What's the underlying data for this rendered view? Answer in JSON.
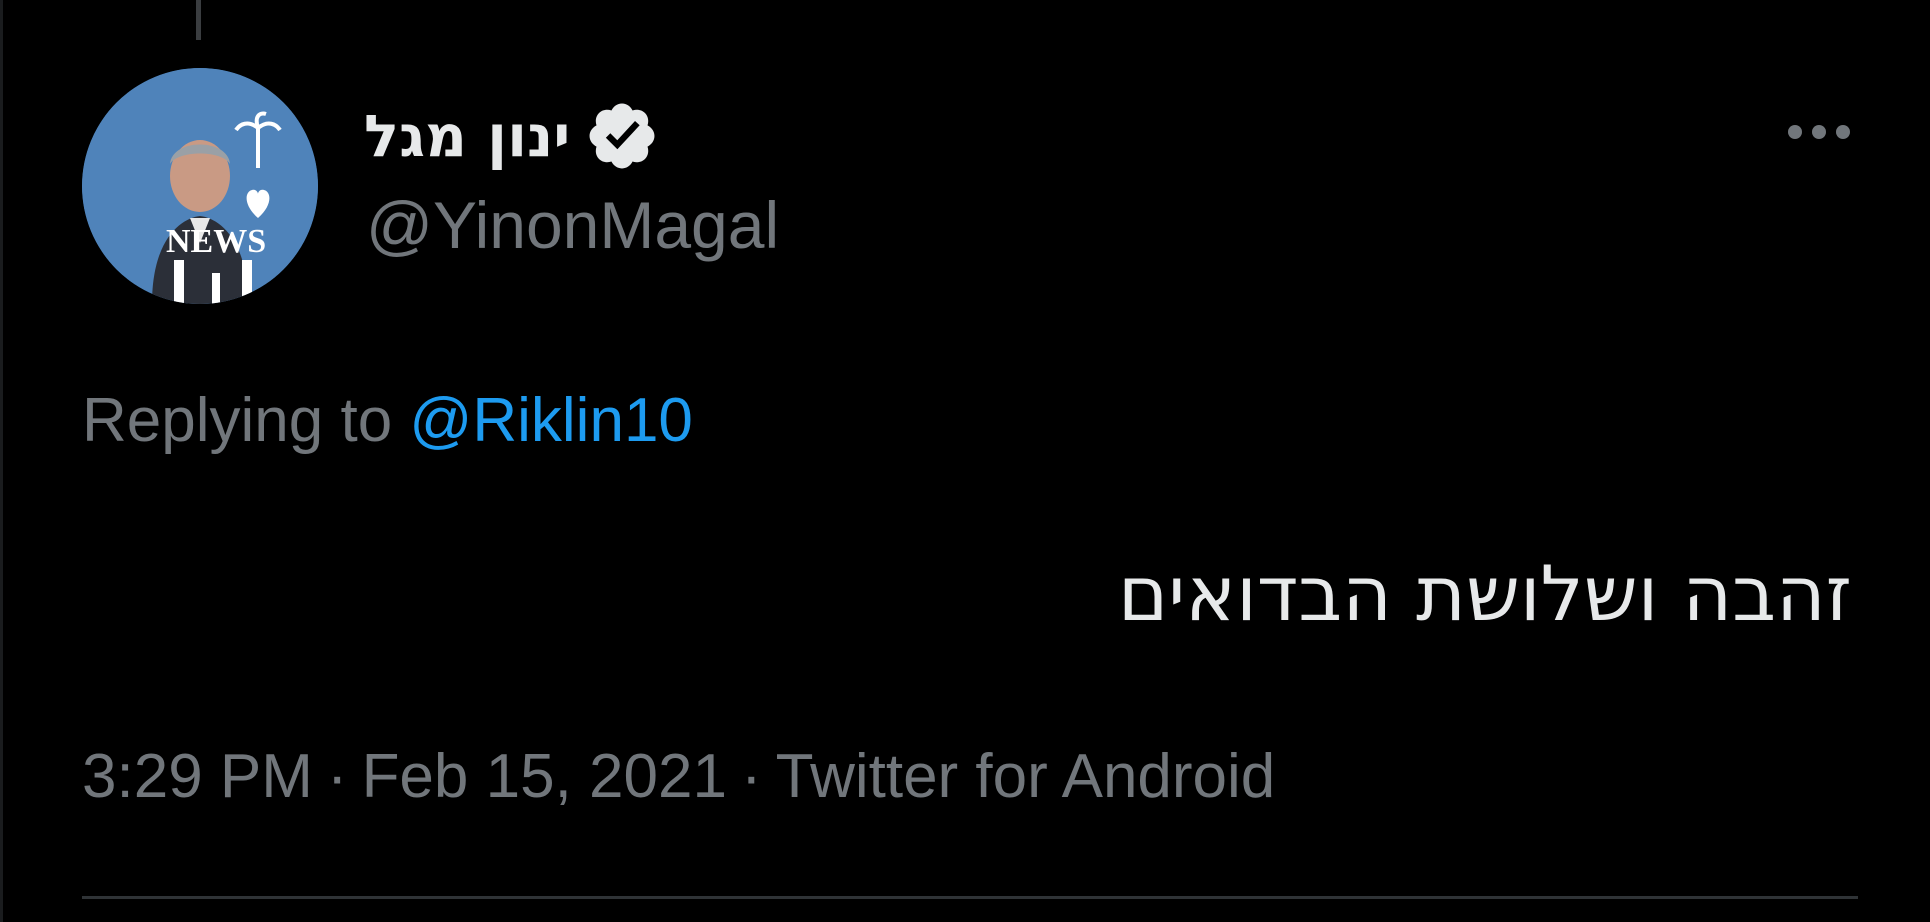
{
  "tweet": {
    "author": {
      "display_name": "ינון מגל",
      "handle": "@YinonMagal",
      "verified": true,
      "avatar_text": "NEWS"
    },
    "reply": {
      "prefix": "Replying to",
      "target": "@Riklin10"
    },
    "text": "זהבה ושלושת הבדואים",
    "meta": {
      "time": "3:29 PM",
      "separator": "·",
      "date": "Feb 15, 2021",
      "source": "Twitter for Android"
    }
  },
  "icons": {
    "verified": "verified-badge-icon",
    "more": "more-options-icon"
  },
  "colors": {
    "background": "#000000",
    "primary_text": "#e7e9ea",
    "secondary_text": "#71767b",
    "link": "#1d9bf0",
    "avatar_bg": "#4a7fb5",
    "divider": "#2f3336"
  }
}
